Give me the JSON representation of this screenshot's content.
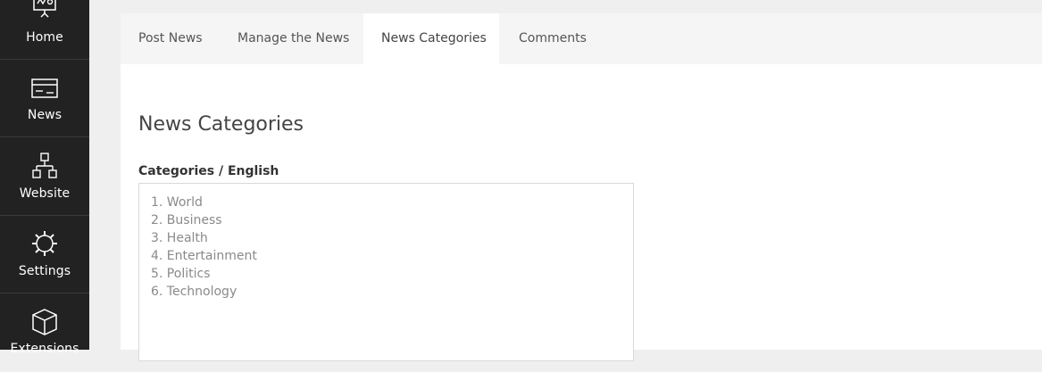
{
  "sidebar": {
    "items": [
      {
        "label": "Home",
        "icon": "presentation-board-icon"
      },
      {
        "label": "News",
        "icon": "card-icon"
      },
      {
        "label": "Website",
        "icon": "sitemap-icon"
      },
      {
        "label": "Settings",
        "icon": "gear-icon"
      },
      {
        "label": "Extensions",
        "icon": "box-icon"
      }
    ]
  },
  "tabs": [
    {
      "label": "Post News",
      "active": false
    },
    {
      "label": "Manage the News",
      "active": false
    },
    {
      "label": "News Categories",
      "active": true
    },
    {
      "label": "Comments",
      "active": false
    }
  ],
  "main": {
    "title": "News Categories",
    "field_label": "Categories / English",
    "categories": [
      "1. World",
      "2. Business",
      "3. Health",
      "4. Entertainment",
      "5. Politics",
      "6. Technology"
    ]
  },
  "colors": {
    "sidebar_bg": "#222222",
    "page_bg": "#efefef",
    "tab_bar_bg": "#f5f5f5",
    "panel_bg": "#ffffff"
  }
}
